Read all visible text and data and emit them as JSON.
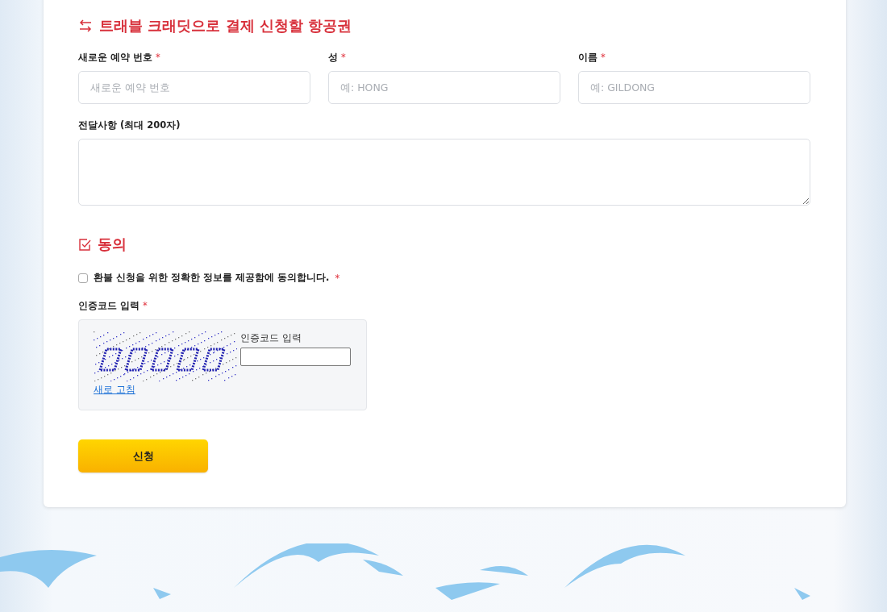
{
  "section_title": "트래블 크래딧으로 결제 신청할 항공권",
  "fields": [
    {
      "label": "새로운 예약 번호",
      "required_mark": "*",
      "placeholder": "새로운 예약 번호"
    },
    {
      "label": "성",
      "required_mark": "*",
      "placeholder": "예: HONG"
    },
    {
      "label": "이름",
      "required_mark": "*",
      "placeholder": "예: GILDONG"
    }
  ],
  "message": {
    "label": "전달사항 (최대 200자)"
  },
  "consent": {
    "title": "동의",
    "label": "환불 신청을 위한 정확한 정보를 제공함에 동의합니다.",
    "required_mark": "*",
    "checked": false
  },
  "captcha": {
    "label": "인증코드 입력",
    "required_mark": "*",
    "input_label": "인증코드 입력",
    "refresh_link": "새로 고침"
  },
  "submit": "신청"
}
